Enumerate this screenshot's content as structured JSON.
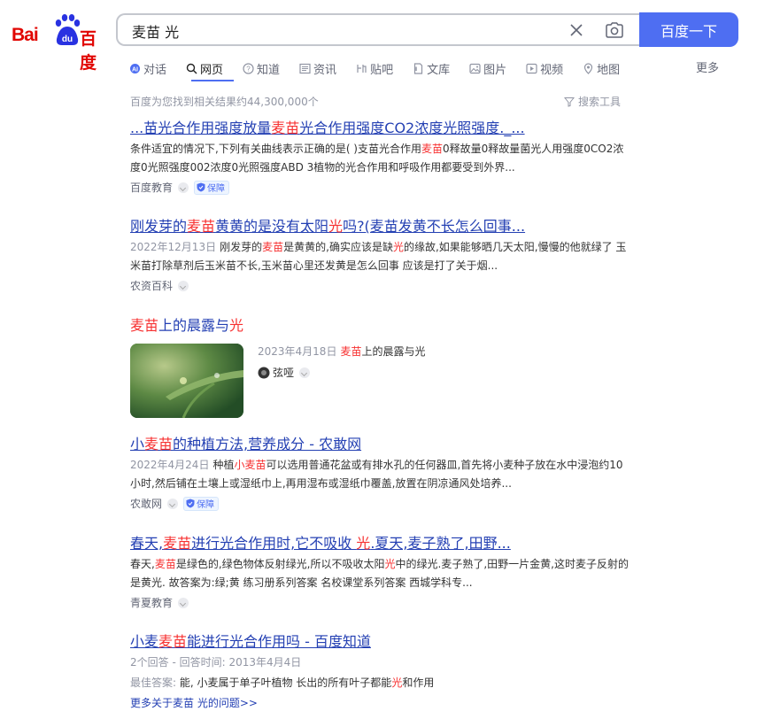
{
  "logo": {
    "bai": "Bai",
    "du": "du",
    "baidu_cn": "百度"
  },
  "search": {
    "query": "麦苗 光",
    "button_label": "百度一下"
  },
  "tabs": [
    {
      "label": "对话",
      "icon": "chat-icon"
    },
    {
      "label": "网页",
      "icon": "search-icon",
      "active": true
    },
    {
      "label": "知道",
      "icon": "question-icon"
    },
    {
      "label": "资讯",
      "icon": "news-icon"
    },
    {
      "label": "贴吧",
      "icon": "tieba-icon"
    },
    {
      "label": "文库",
      "icon": "doc-icon"
    },
    {
      "label": "图片",
      "icon": "image-icon"
    },
    {
      "label": "视频",
      "icon": "video-icon"
    },
    {
      "label": "地图",
      "icon": "map-icon"
    }
  ],
  "more_tab": "更多",
  "result_count": "百度为您找到相关结果约44,300,000个",
  "search_tools": "搜索工具",
  "results": [
    {
      "title_parts": [
        "...苗光合作用强度放量",
        "麦苗",
        "光合作用强度CO2浓度光照强度._..."
      ],
      "abstract_parts": [
        "条件适宜的情况下,下列有关曲线表示正确的是( )支苗光合作用",
        "麦苗",
        "0释故量0释故量菌光人用强度0CO2浓度0光照强度002浓度0光照强度ABD 3植物的光合作用和呼吸作用都要受到外界..."
      ],
      "source": "百度教育",
      "badge": "保障"
    },
    {
      "title_parts": [
        "刚发芽的",
        "麦苗",
        "黄黄的是没有太阳",
        "光",
        "吗?(麦苗发黄不长怎么回事..."
      ],
      "date": "2022年12月13日",
      "abstract_parts": [
        "刚发芽的",
        "麦苗",
        "是黄黄的,确实应该是缺",
        "光",
        "的缘故,如果能够晒几天太阳,慢慢的他就绿了 玉米苗打除草剂后玉米苗不长,玉米苗心里还发黄是怎么回事 应该是打了关于烟..."
      ],
      "source": "农资百科"
    },
    {
      "title_parts": [
        "麦苗",
        "上的晨露与",
        "光"
      ],
      "date": "2023年4月18日",
      "abstract_parts": [
        "麦苗",
        "上的晨露与光"
      ],
      "source": "弦哑"
    },
    {
      "title_parts": [
        "小",
        "麦苗",
        "的种植方法,营养成分 - 农敢网"
      ],
      "date": "2022年4月24日",
      "abstract_parts": [
        "种植",
        "小麦苗",
        "可以选用普通花盆或有排水孔的任何器皿,首先将小麦种子放在水中浸泡约10小时,然后铺在土壤上或湿纸巾上,再用湿布或湿纸巾覆盖,放置在阴凉通风处培养..."
      ],
      "source": "农敢网",
      "badge": "保障"
    },
    {
      "title_parts": [
        "春天,",
        "麦苗",
        "进行光合作用时,它不吸收 ",
        "光",
        ".夏天,麦子熟了,田野..."
      ],
      "abstract_parts": [
        "春天,",
        "麦苗",
        "是绿色的,绿色物体反射绿光,所以不吸收太阳",
        "光",
        "中的绿光.麦子熟了,田野一片金黄,这时麦子反射的是黄光. 故答案为:绿;黄 练习册系列答案 名校课堂系列答案 西城学科专..."
      ],
      "source": "青夏教育"
    },
    {
      "title_parts": [
        "小麦",
        "麦苗",
        "能进行光合作用吗 - 百度知道"
      ],
      "meta": "2个回答 - 回答时间: 2013年4月4日",
      "answer_label": "最佳答案:",
      "answer_parts": [
        " 能, 小麦属于单子叶植物 长出的所有叶子都能",
        "光",
        "和作用"
      ],
      "more_link": "更多关于麦苗 光的问题>>"
    }
  ],
  "colors": {
    "accent": "#4e6ef2",
    "highlight": "#f73131",
    "link": "#2440b3"
  }
}
